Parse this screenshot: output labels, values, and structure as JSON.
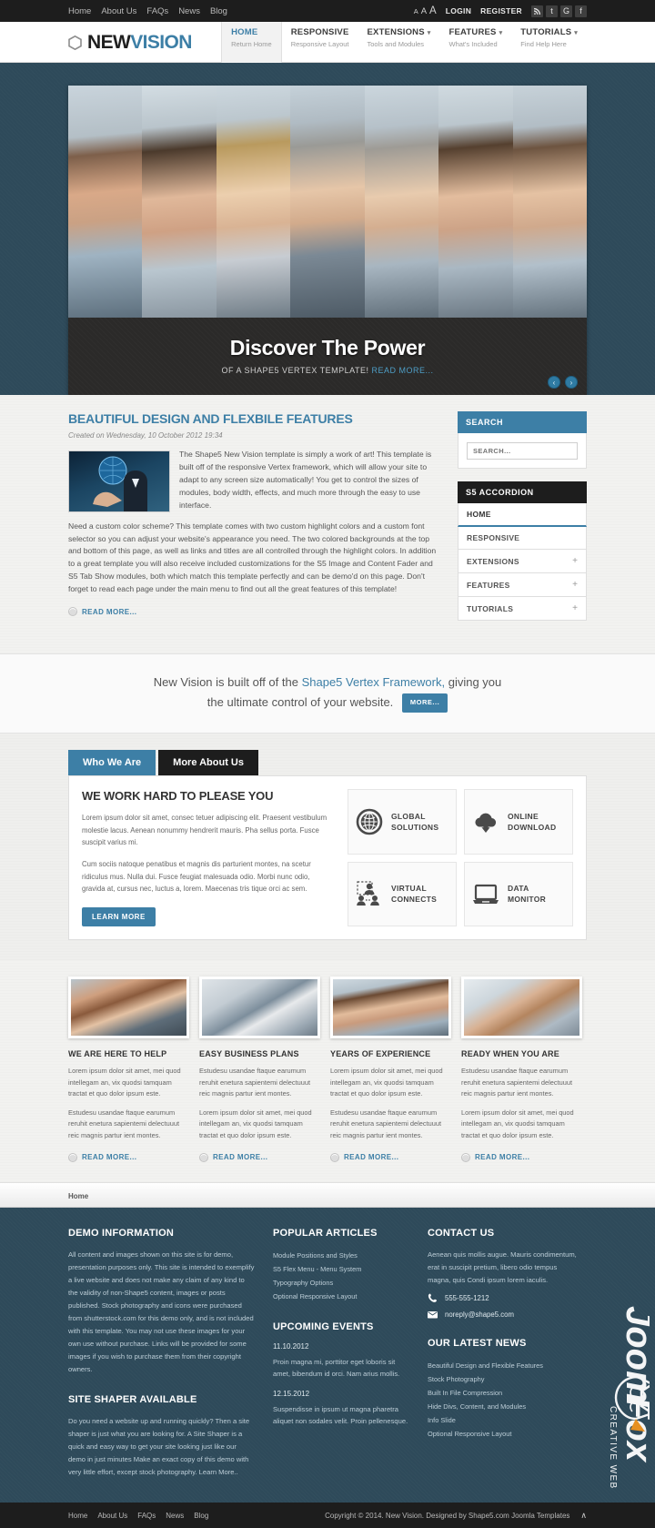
{
  "colors": {
    "accent": "#3d7fa6",
    "dark": "#1d1d1d",
    "footer_bg": "#2e4a5a",
    "body_bg": "#f2f2f0"
  },
  "topbar": {
    "menu": [
      "Home",
      "About Us",
      "FAQs",
      "News",
      "Blog"
    ],
    "font_sizer": [
      "A",
      "A",
      "A"
    ],
    "login_label": "LOGIN",
    "register_label": "REGISTER",
    "socials": [
      "rss-icon",
      "twitter-icon",
      "google-icon",
      "facebook-icon"
    ],
    "social_glyphs": [
      "◔",
      "t",
      "G",
      "f"
    ]
  },
  "header": {
    "logo_part1": "NEW",
    "logo_part2": "VISION",
    "nav": [
      {
        "label": "HOME",
        "desc": "Return Home",
        "active": true,
        "caret": false
      },
      {
        "label": "RESPONSIVE",
        "desc": "Responsive Layout",
        "active": false,
        "caret": false
      },
      {
        "label": "EXTENSIONS",
        "desc": "Tools and Modules",
        "active": false,
        "caret": true
      },
      {
        "label": "FEATURES",
        "desc": "What's Included",
        "active": false,
        "caret": true
      },
      {
        "label": "TUTORIALS",
        "desc": "Find Help Here",
        "active": false,
        "caret": true
      }
    ]
  },
  "slider": {
    "title": "Discover The Power",
    "subtitle": "OF A SHAPE5 VERTEX TEMPLATE!",
    "read_more": "READ MORE...",
    "prev": "‹",
    "next": "›"
  },
  "article": {
    "title": "BEAUTIFUL DESIGN AND FLEXBILE FEATURES",
    "date": "Created on Wednesday, 10 October 2012 19:34",
    "p1": "The Shape5 New Vision template is simply a work of art! This template is built off of the responsive Vertex framework, which will allow your site to adapt to any screen size automatically! You get to control the sizes of modules, body width, effects, and much more through the easy to use interface.",
    "p2": "Need a custom color scheme? This template comes with two custom highlight colors and a custom font selector so you can adjust your website's appearance you need. The two colored backgrounds at the top and bottom of this page, as well as links and titles are all controlled through the highlight colors. In addition to a great template you will also receive included customizations for the S5 Image and Content Fader and S5 Tab Show modules, both which match this template perfectly and can be demo'd on this page. Don't forget to read each page under the main menu to find out all the great features of this template!",
    "read_more": "READ MORE..."
  },
  "sidebar": {
    "search_title": "SEARCH",
    "search_placeholder": "SEARCH...",
    "search_value": "",
    "accordion_title": "S5 ACCORDION",
    "accordion": [
      {
        "label": "HOME",
        "plus": "",
        "active": true
      },
      {
        "label": "RESPONSIVE",
        "plus": "",
        "active": false
      },
      {
        "label": "EXTENSIONS",
        "plus": "+",
        "active": false
      },
      {
        "label": "FEATURES",
        "plus": "+",
        "active": false
      },
      {
        "label": "TUTORIALS",
        "plus": "+",
        "active": false
      }
    ]
  },
  "callout": {
    "line1_a": "New Vision is built off of the ",
    "link": "Shape5 Vertex Framework,",
    "line1_b": " giving you",
    "line2": "the ultimate control of your website.",
    "button": "MORE..."
  },
  "tabs": {
    "items": [
      {
        "label": "Who We Are",
        "selected": true
      },
      {
        "label": "More About Us",
        "selected": false
      }
    ],
    "panel_title": "WE WORK HARD TO PLEASE YOU",
    "panel_p1": "Lorem ipsum dolor sit amet, consec tetuer adipiscing elit. Praesent vestibulum molestie lacus. Aenean nonummy hendrerit mauris. Pha sellus porta. Fusce suscipit varius mi.",
    "panel_p2": "Cum sociis natoque penatibus et magnis dis parturient montes, na scetur ridiculus mus. Nulla dui. Fusce feugiat malesuada odio. Morbi nunc odio, gravida at, cursus nec, luctus a, lorem. Maecenas tris tique orci ac sem.",
    "panel_button": "LEARN MORE",
    "features": [
      {
        "icon": "globe-icon",
        "line1": "GLOBAL",
        "line2": "SOLUTIONS"
      },
      {
        "icon": "cloud-download-icon",
        "line1": "ONLINE",
        "line2": "DOWNLOAD"
      },
      {
        "icon": "virtual-connects-icon",
        "line1": "VIRTUAL",
        "line2": "CONNECTS"
      },
      {
        "icon": "laptop-icon",
        "line1": "DATA",
        "line2": "MONITOR"
      }
    ]
  },
  "four_columns": [
    {
      "title": "WE ARE HERE TO HELP",
      "p1": "Lorem ipsum dolor sit amet, mei quod intellegam an, vix quodsi tamquam tractat et quo dolor ipsum este.",
      "p2": "Estudesu usandae ftaque earumum reruhit enetura sapientemi delectuuut reic magnis partur ient montes.",
      "read_more": "READ MORE..."
    },
    {
      "title": "EASY BUSINESS PLANS",
      "p1": "Estudesu usandae ftaque earumum reruhit enetura sapientemi delectuuut reic magnis partur ient montes.",
      "p2": "Lorem ipsum dolor sit amet, mei quod intellegam an, vix quodsi tamquam tractat et quo dolor ipsum este.",
      "read_more": "READ MORE..."
    },
    {
      "title": "YEARS OF EXPERIENCE",
      "p1": "Lorem ipsum dolor sit amet, mei quod intellegam an, vix quodsi tamquam tractat et quo dolor ipsum este.",
      "p2": "Estudesu usandae ftaque earumum reruhit enetura sapientemi delectuuut reic magnis partur ient montes.",
      "read_more": "READ MORE..."
    },
    {
      "title": "READY WHEN YOU ARE",
      "p1": "Estudesu usandae ftaque earumum reruhit enetura sapientemi delectuuut reic magnis partur ient montes.",
      "p2": "Lorem ipsum dolor sit amet, mei quod intellegam an, vix quodsi tamquam tractat et quo dolor ipsum este.",
      "read_more": "READ MORE..."
    }
  ],
  "breadcrumb": "Home",
  "footer": {
    "demo_title": "DEMO INFORMATION",
    "demo_text": "All content and images shown on this site is for demo, presentation purposes only. This site is intended to exemplify a live website and does not make any claim of any kind to the validity of non-Shape5 content, images or posts published. Stock photography and icons were purchased from shutterstock.com for this demo only, and is not included with this template. You may not use these images for your own use without purchase. Links will be provided for some images if you wish to purchase them from their copyright owners.",
    "shaper_title": "SITE SHAPER AVAILABLE",
    "shaper_text": "Do you need a website up and running quickly? Then a site shaper is just what you are looking for. A Site Shaper is a quick and easy way to get your site looking just like our demo in just minutes Make an exact copy of this demo with very little effort, except stock photography. Learn More..",
    "popular_title": "POPULAR ARTICLES",
    "popular": [
      "Module Positions and Styles",
      "S5 Flex Menu - Menu System",
      "Typography Options",
      "Optional Responsive Layout"
    ],
    "events_title": "UPCOMING EVENTS",
    "events": [
      {
        "date": "11.10.2012",
        "text": "Proin magna mi, porttitor eget loboris sit amet, bibendum id orci. Nam arius mollis."
      },
      {
        "date": "12.15.2012",
        "text": "Suspendisse in ipsum ut magna pharetra aliquet non sodales velit. Proin pellenesque."
      }
    ],
    "contact_title": "CONTACT US",
    "contact_text": "Aenean quis mollis augue. Mauris condimentum, erat in suscipit pretium, libero odio tempus magna, quis Condi ipsum lorem iaculis.",
    "phone": "555-555-1212",
    "email": "noreply@shape5.com",
    "news_title": "OUR LATEST NEWS",
    "news": [
      "Beautiful Design and Flexible Features",
      "Stock Photography",
      "Built In File Compression",
      "Hide Divs, Content, and Modules",
      "Info Slide",
      "Optional Responsive Layout"
    ],
    "watermark_name": "JoomFox",
    "watermark_tagline": "CREATIVE WEB STUDIO"
  },
  "bottombar": {
    "menu": [
      "Home",
      "About Us",
      "FAQs",
      "News",
      "Blog"
    ],
    "copyright": "Copyright © 2014. New Vision. Designed by Shape5.com Joomla Templates",
    "up_arrow": "∧"
  }
}
